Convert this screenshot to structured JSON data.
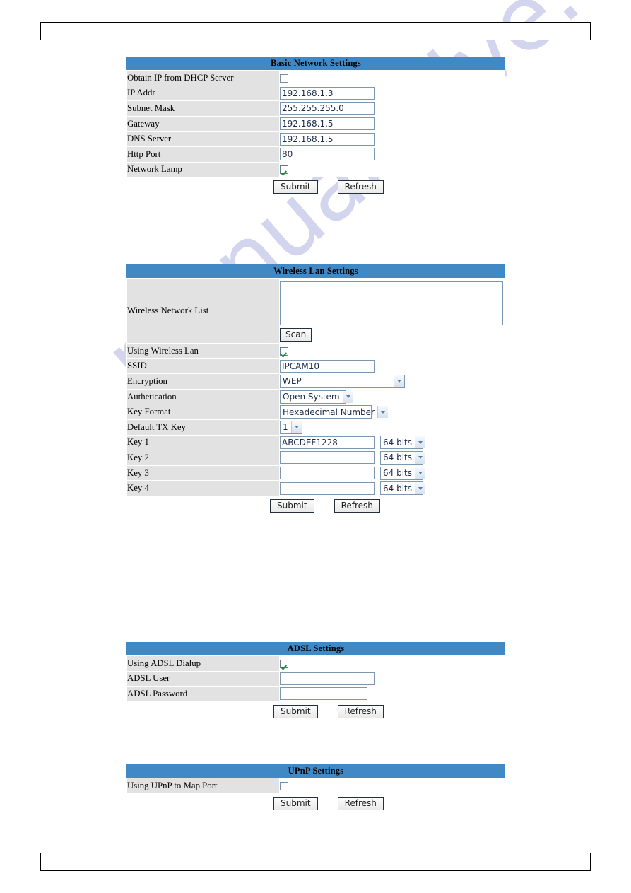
{
  "page": {
    "watermark": "manualshive.com",
    "header_bar_text": "",
    "footer_bar_text": ""
  },
  "colors": {
    "panel_header_blue": "#4089c4",
    "label_cell_grey": "#e2e2e2",
    "field_border": "#7d97b0",
    "check_green": "#1f8b33",
    "watermark": "#b9bce4"
  },
  "common": {
    "submit_label": "Submit",
    "refresh_label": "Refresh"
  },
  "basic_network": {
    "title": "Basic Network Settings",
    "rows": [
      {
        "label": "Obtain IP from DHCP Server",
        "type": "checkbox",
        "checked": false
      },
      {
        "label": "IP Addr",
        "type": "text",
        "value": "192.168.1.3"
      },
      {
        "label": "Subnet Mask",
        "type": "text",
        "value": "255.255.255.0"
      },
      {
        "label": "Gateway",
        "type": "text",
        "value": "192.168.1.5"
      },
      {
        "label": "DNS Server",
        "type": "text",
        "value": "192.168.1.5"
      },
      {
        "label": "Http Port",
        "type": "text",
        "value": "80"
      },
      {
        "label": "Network Lamp",
        "type": "checkbox",
        "checked": true
      }
    ]
  },
  "wireless_lan": {
    "title": "Wireless Lan Settings",
    "network_list_label": "Wireless Network List",
    "network_list_items": [],
    "scan_label": "Scan",
    "rows": [
      {
        "label": "Using Wireless Lan",
        "type": "checkbox",
        "checked": true
      },
      {
        "label": "SSID",
        "type": "text",
        "value": "IPCAM10"
      },
      {
        "label": "Encryption",
        "type": "select",
        "value": "WEP"
      },
      {
        "label": "Authetication",
        "type": "select",
        "value": "Open System"
      },
      {
        "label": "Key Format",
        "type": "select",
        "value": "Hexadecimal Number"
      },
      {
        "label": "Default TX Key",
        "type": "select",
        "value": "1"
      }
    ],
    "keys": [
      {
        "label": "Key 1",
        "value": "ABCDEF1228",
        "bits": "64 bits"
      },
      {
        "label": "Key 2",
        "value": "",
        "bits": "64 bits"
      },
      {
        "label": "Key 3",
        "value": "",
        "bits": "64 bits"
      },
      {
        "label": "Key 4",
        "value": "",
        "bits": "64 bits"
      }
    ]
  },
  "adsl": {
    "title": "ADSL Settings",
    "rows": [
      {
        "label": "Using ADSL Dialup",
        "type": "checkbox",
        "checked": true
      },
      {
        "label": "ADSL User",
        "type": "text",
        "value": ""
      },
      {
        "label": "ADSL Password",
        "type": "text",
        "value": ""
      }
    ]
  },
  "upnp": {
    "title": "UPnP Settings",
    "rows": [
      {
        "label": "Using UPnP to Map Port",
        "type": "checkbox",
        "checked": false
      }
    ]
  }
}
